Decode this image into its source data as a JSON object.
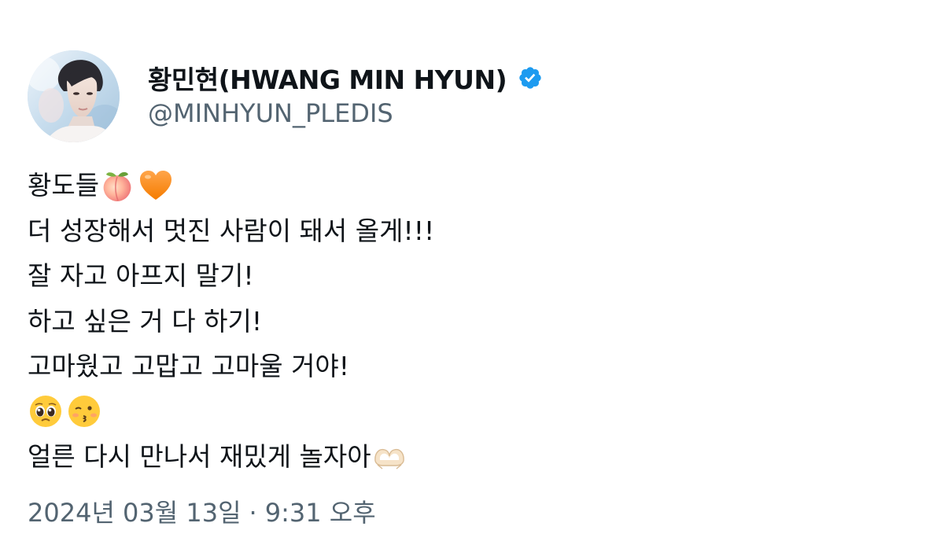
{
  "author": {
    "display_name": "황민현(HWANG MIN HYUN)",
    "handle": "@MINHYUN_PLEDIS",
    "verified": true,
    "verified_color": "#1d9bf0"
  },
  "tweet": {
    "lines": [
      {
        "text": "황도들",
        "emoji_after": [
          "peach",
          "orange-heart"
        ]
      },
      {
        "text": "더 성장해서 멋진 사람이 돼서 올게!!!"
      },
      {
        "text": "잘 자고 아프지 말기!"
      },
      {
        "text": "하고 싶은 거 다 하기!"
      },
      {
        "text": "고마웠고 고맙고 고마울 거야!"
      },
      {
        "text": "",
        "emoji_after": [
          "pleading-face",
          "kissing-face"
        ]
      },
      {
        "text": "얼른 다시 만나서 재밌게 놀자아",
        "emoji_after": [
          "heart-hands"
        ]
      }
    ],
    "date": "2024년 03월 13일",
    "separator": "·",
    "time": "9:31 오후"
  },
  "colors": {
    "text_primary": "#0f1419",
    "text_secondary": "#536471",
    "background": "#ffffff"
  }
}
